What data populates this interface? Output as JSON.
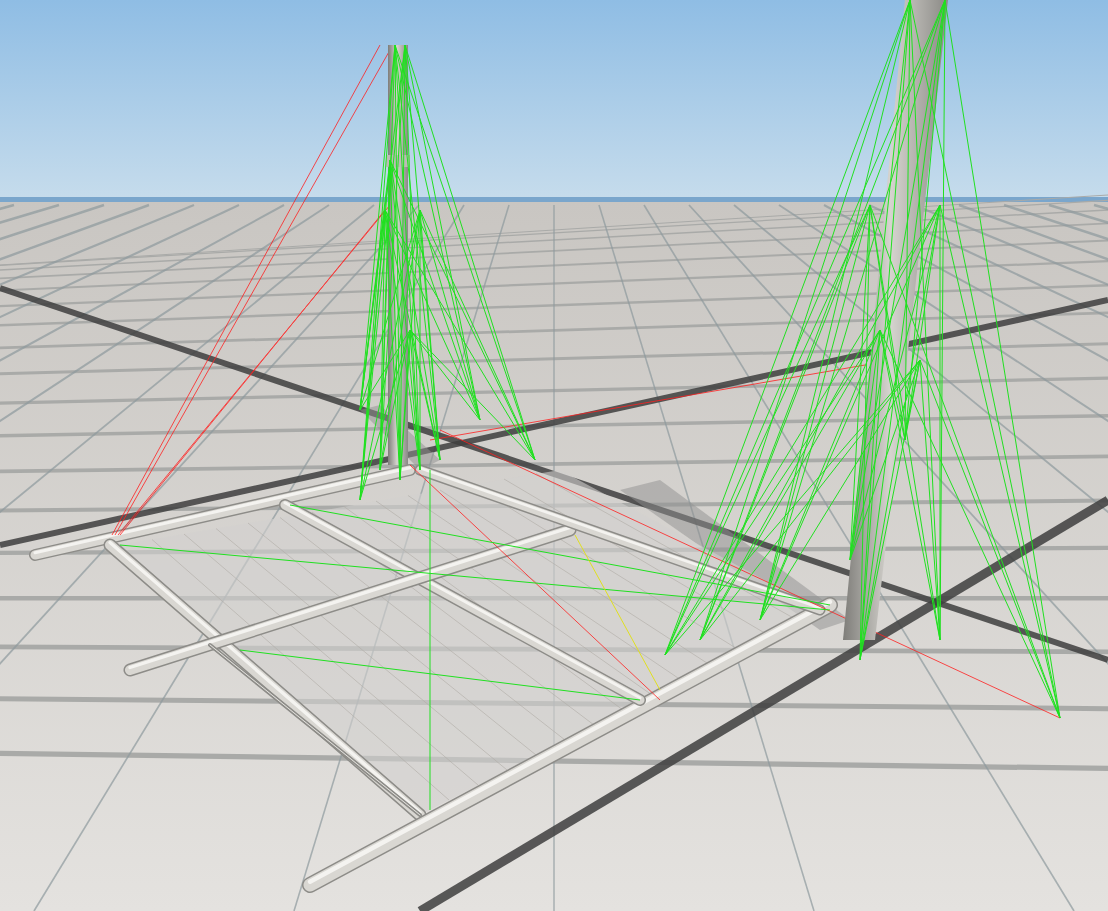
{
  "viewport": {
    "kind": "scene3d"
  }
}
